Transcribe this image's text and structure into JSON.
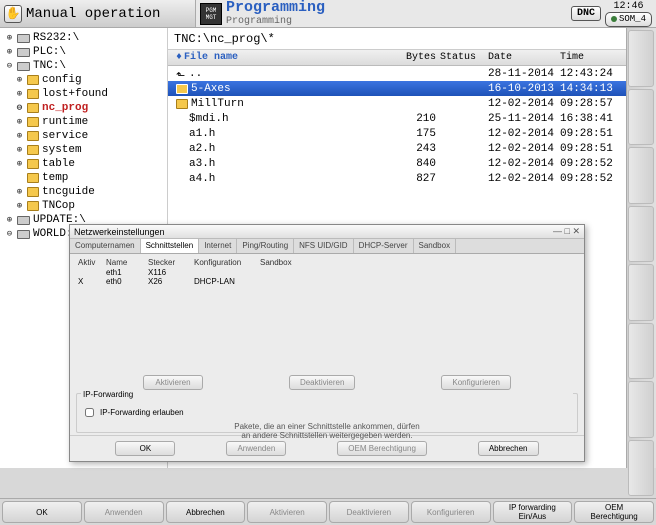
{
  "header": {
    "left_title": "Manual operation",
    "pgm_badge_top": "PGM",
    "pgm_badge_bot": "MGT",
    "center_title": "Programming",
    "center_sub": "Programming",
    "dnc": "DNC",
    "time": "12:46",
    "som_label": "SOM_4"
  },
  "tree": {
    "items": [
      {
        "exp": "⊕",
        "icon": "drive",
        "label": "RS232:\\",
        "depth": 0
      },
      {
        "exp": "⊕",
        "icon": "drive",
        "label": "PLC:\\",
        "depth": 0
      },
      {
        "exp": "⊖",
        "icon": "drive",
        "label": "TNC:\\",
        "depth": 0
      },
      {
        "exp": "⊕",
        "icon": "folder",
        "label": "config",
        "depth": 1
      },
      {
        "exp": "⊕",
        "icon": "folder",
        "label": "lost+found",
        "depth": 1
      },
      {
        "exp": "⊖",
        "icon": "folder",
        "label": "nc_prog",
        "depth": 1,
        "cls": "nc-prog"
      },
      {
        "exp": "⊕",
        "icon": "folder",
        "label": "runtime",
        "depth": 1
      },
      {
        "exp": "⊕",
        "icon": "folder",
        "label": "service",
        "depth": 1
      },
      {
        "exp": "⊕",
        "icon": "folder",
        "label": "system",
        "depth": 1
      },
      {
        "exp": "⊕",
        "icon": "folder",
        "label": "table",
        "depth": 1
      },
      {
        "exp": "",
        "icon": "folder",
        "label": "temp",
        "depth": 1
      },
      {
        "exp": "⊕",
        "icon": "folder",
        "label": "tncguide",
        "depth": 1
      },
      {
        "exp": "⊕",
        "icon": "folder",
        "label": "TNCop",
        "depth": 1
      },
      {
        "exp": "⊕",
        "icon": "drive",
        "label": "UPDATE:\\",
        "depth": 0
      },
      {
        "exp": "⊖",
        "icon": "drive",
        "label": "WORLD:\\",
        "depth": 0
      }
    ]
  },
  "path": "TNC:\\nc_prog\\*",
  "columns": {
    "name": "File name",
    "bytes": "Bytes",
    "status": "Status",
    "date": "Date",
    "time": "Time"
  },
  "files": [
    {
      "icon": "up",
      "name": "..",
      "bytes": "",
      "date": "28-11-2014",
      "time": "12:43:24",
      "selected": false
    },
    {
      "icon": "folder",
      "name": "5-Axes",
      "bytes": "",
      "date": "16-10-2013",
      "time": "14:34:13",
      "selected": true
    },
    {
      "icon": "folder",
      "name": "MillTurn",
      "bytes": "",
      "date": "12-02-2014",
      "time": "09:28:57",
      "selected": false
    },
    {
      "icon": "file",
      "name": "$mdi.h",
      "bytes": "210",
      "date": "25-11-2014",
      "time": "16:38:41",
      "selected": false
    },
    {
      "icon": "file",
      "name": "a1.h",
      "bytes": "175",
      "date": "12-02-2014",
      "time": "09:28:51",
      "selected": false
    },
    {
      "icon": "file",
      "name": "a2.h",
      "bytes": "243",
      "date": "12-02-2014",
      "time": "09:28:51",
      "selected": false
    },
    {
      "icon": "file",
      "name": "a3.h",
      "bytes": "840",
      "date": "12-02-2014",
      "time": "09:28:52",
      "selected": false
    },
    {
      "icon": "file",
      "name": "a4.h",
      "bytes": "827",
      "date": "12-02-2014",
      "time": "09:28:52",
      "selected": false
    }
  ],
  "dialog": {
    "title": "Netzwerkeinstellungen",
    "tabs": [
      "Computernamen",
      "Schnittstellen",
      "Internet",
      "Ping/Routing",
      "NFS UID/GID",
      "DHCP-Server",
      "Sandbox"
    ],
    "active_tab": 1,
    "iface_headers": [
      "Aktiv",
      "Name",
      "Stecker",
      "Konfiguration",
      "Sandbox"
    ],
    "ifaces": [
      [
        "",
        "eth1",
        "X116",
        "",
        ""
      ],
      [
        "X",
        "eth0",
        "X26",
        "DHCP-LAN",
        ""
      ]
    ],
    "mid_buttons": [
      "Aktivieren",
      "Deaktivieren",
      "Konfigurieren"
    ],
    "ip_legend": "IP-Forwarding",
    "ip_checkbox": "IP-Forwarding erlauben",
    "ip_note1": "Pakete, die an einer Schnittstelle ankommen, dürfen",
    "ip_note2": "an andere Schnittstellen weitergegeben werden.",
    "footer": [
      "OK",
      "Anwenden",
      "OEM Berechtigung",
      "Abbrechen"
    ]
  },
  "softkeys": [
    {
      "label": "OK",
      "enabled": true
    },
    {
      "label": "Anwenden",
      "enabled": false
    },
    {
      "label": "Abbrechen",
      "enabled": true
    },
    {
      "label": "Aktivieren",
      "enabled": false
    },
    {
      "label": "Deaktivieren",
      "enabled": false
    },
    {
      "label": "Konfigurieren",
      "enabled": false
    },
    {
      "label": "IP forwarding\nEin/Aus",
      "enabled": true
    },
    {
      "label": "OEM\nBerechtigung",
      "enabled": true
    }
  ]
}
